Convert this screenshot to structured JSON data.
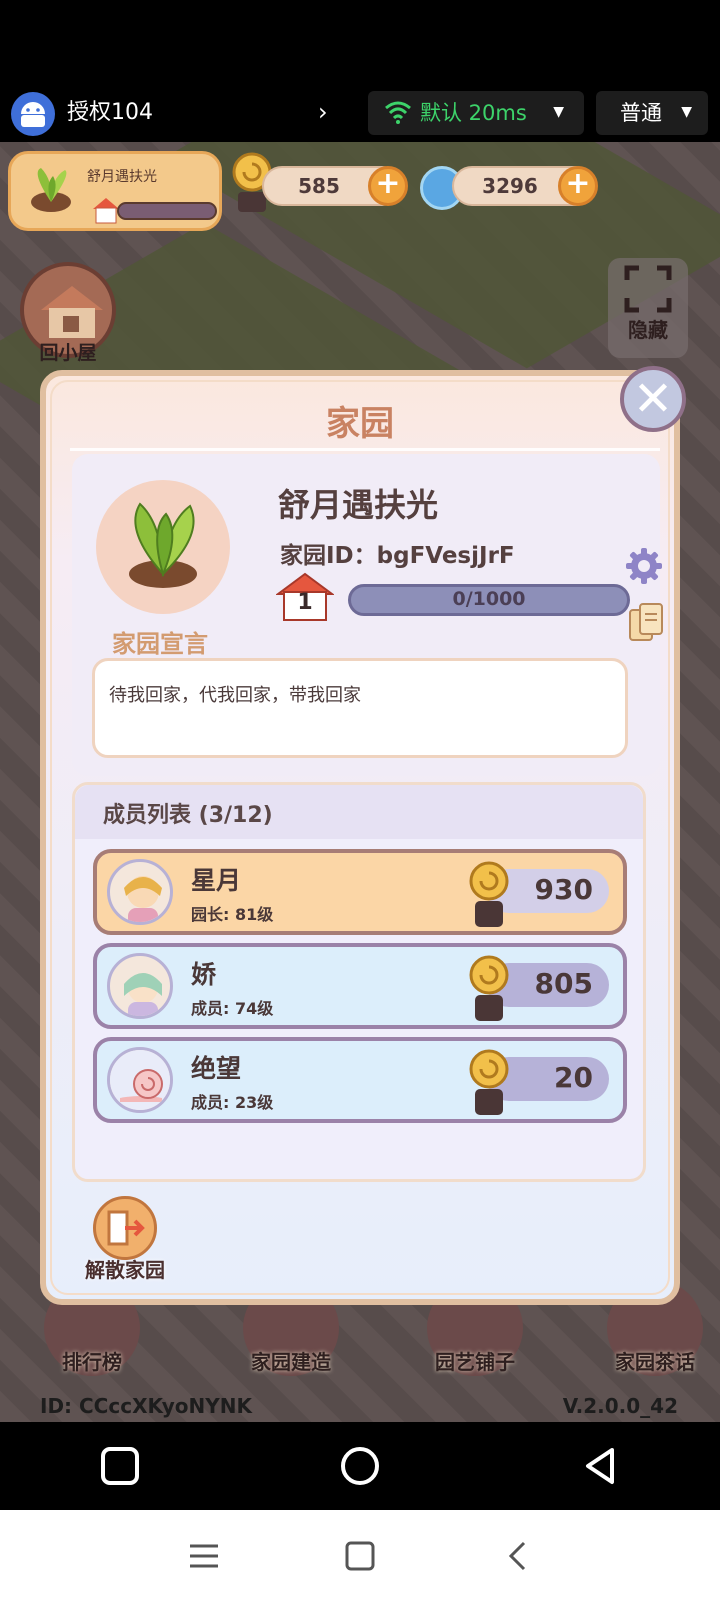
{
  "remote_bar": {
    "device_name": "授权104",
    "network_label": "默认 20ms",
    "quality_label": "普通"
  },
  "player": {
    "name": "舒月遇扶光"
  },
  "resources": {
    "snail_coins": "585",
    "swirl_gems": "3296"
  },
  "side_buttons": {
    "home_label": "回小屋",
    "hide_label": "隐藏"
  },
  "modal": {
    "title": "家园",
    "home_name": "舒月遇扶光",
    "home_id_label": "家园ID：",
    "home_id_value": "bgFVesjJrF",
    "level": "1",
    "exp_text": "0/1000",
    "exp_fraction": 0.0,
    "declaration_label": "家园宣言",
    "declaration_text": "待我回家，代我回家，带我回家",
    "members_title": "成员列表 (3/12)",
    "members": [
      {
        "name": "星月",
        "role": "园长: 81级",
        "score": "930",
        "leader": true
      },
      {
        "name": "娇",
        "role": "成员: 74级",
        "score": "805",
        "leader": false
      },
      {
        "name": "绝望",
        "role": "成员: 23级",
        "score": "20",
        "leader": false
      }
    ],
    "disband_label": "解散家园"
  },
  "bottom_nav": {
    "items": [
      "排行榜",
      "家园建造",
      "园艺铺子",
      "家园茶话"
    ]
  },
  "footer": {
    "uid": "ID: CCccXKyoNYNK",
    "version": "V.2.0.0_42"
  },
  "colors": {
    "accent_title": "#c98262",
    "network_green": "#3dd36a",
    "leader_row": "#fbd6a6",
    "member_row": "#dceefb"
  }
}
